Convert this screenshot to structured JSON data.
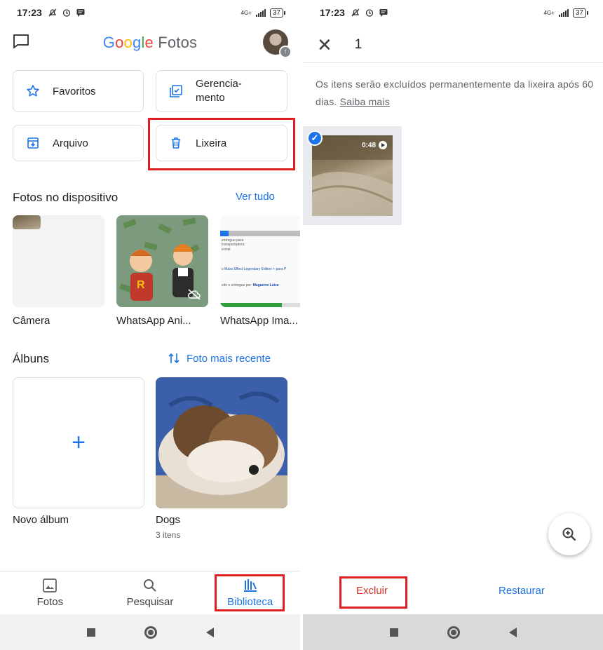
{
  "left": {
    "status": {
      "time": "17:23",
      "battery": "37",
      "net": "4G+"
    },
    "app_title": {
      "google": "Google",
      "fotos": "Fotos"
    },
    "cards": {
      "favoritos": "Favoritos",
      "gerenciamento_line1": "Gerencia-",
      "gerenciamento_line2": "mento",
      "arquivo": "Arquivo",
      "lixeira": "Lixeira"
    },
    "device_section": {
      "title": "Fotos no dispositivo",
      "link": "Ver tudo"
    },
    "device_folders": [
      {
        "label": "Câmera"
      },
      {
        "label": "WhatsApp Ani..."
      },
      {
        "label": "WhatsApp Ima..."
      }
    ],
    "screenshot_text": {
      "line1": "entregue para",
      "line2": "transportadora",
      "line3": "ermal",
      "line4": "o Mass Effect Legendary Edition + para P",
      "line5": "eito e entregue por:",
      "line6": "Magazine Luiza"
    },
    "albums_section": {
      "title": "Álbuns",
      "sort": "Foto mais recente"
    },
    "albums": [
      {
        "label": "Novo álbum",
        "sub": ""
      },
      {
        "label": "Dogs",
        "sub": "3 itens"
      }
    ],
    "nav": {
      "fotos": "Fotos",
      "pesquisar": "Pesquisar",
      "biblioteca": "Biblioteca"
    },
    "colors": {
      "accent": "#1a73e8",
      "highlight": "#e02020"
    }
  },
  "right": {
    "status": {
      "time": "17:23",
      "battery": "37",
      "net": "4G+"
    },
    "selection_count": "1",
    "notice": "Os itens serão excluídos permanentemente da lixeira após 60 dias.",
    "notice_link": "Saiba mais",
    "video_duration": "0:48",
    "actions": {
      "delete": "Excluir",
      "restore": "Restaurar"
    }
  }
}
